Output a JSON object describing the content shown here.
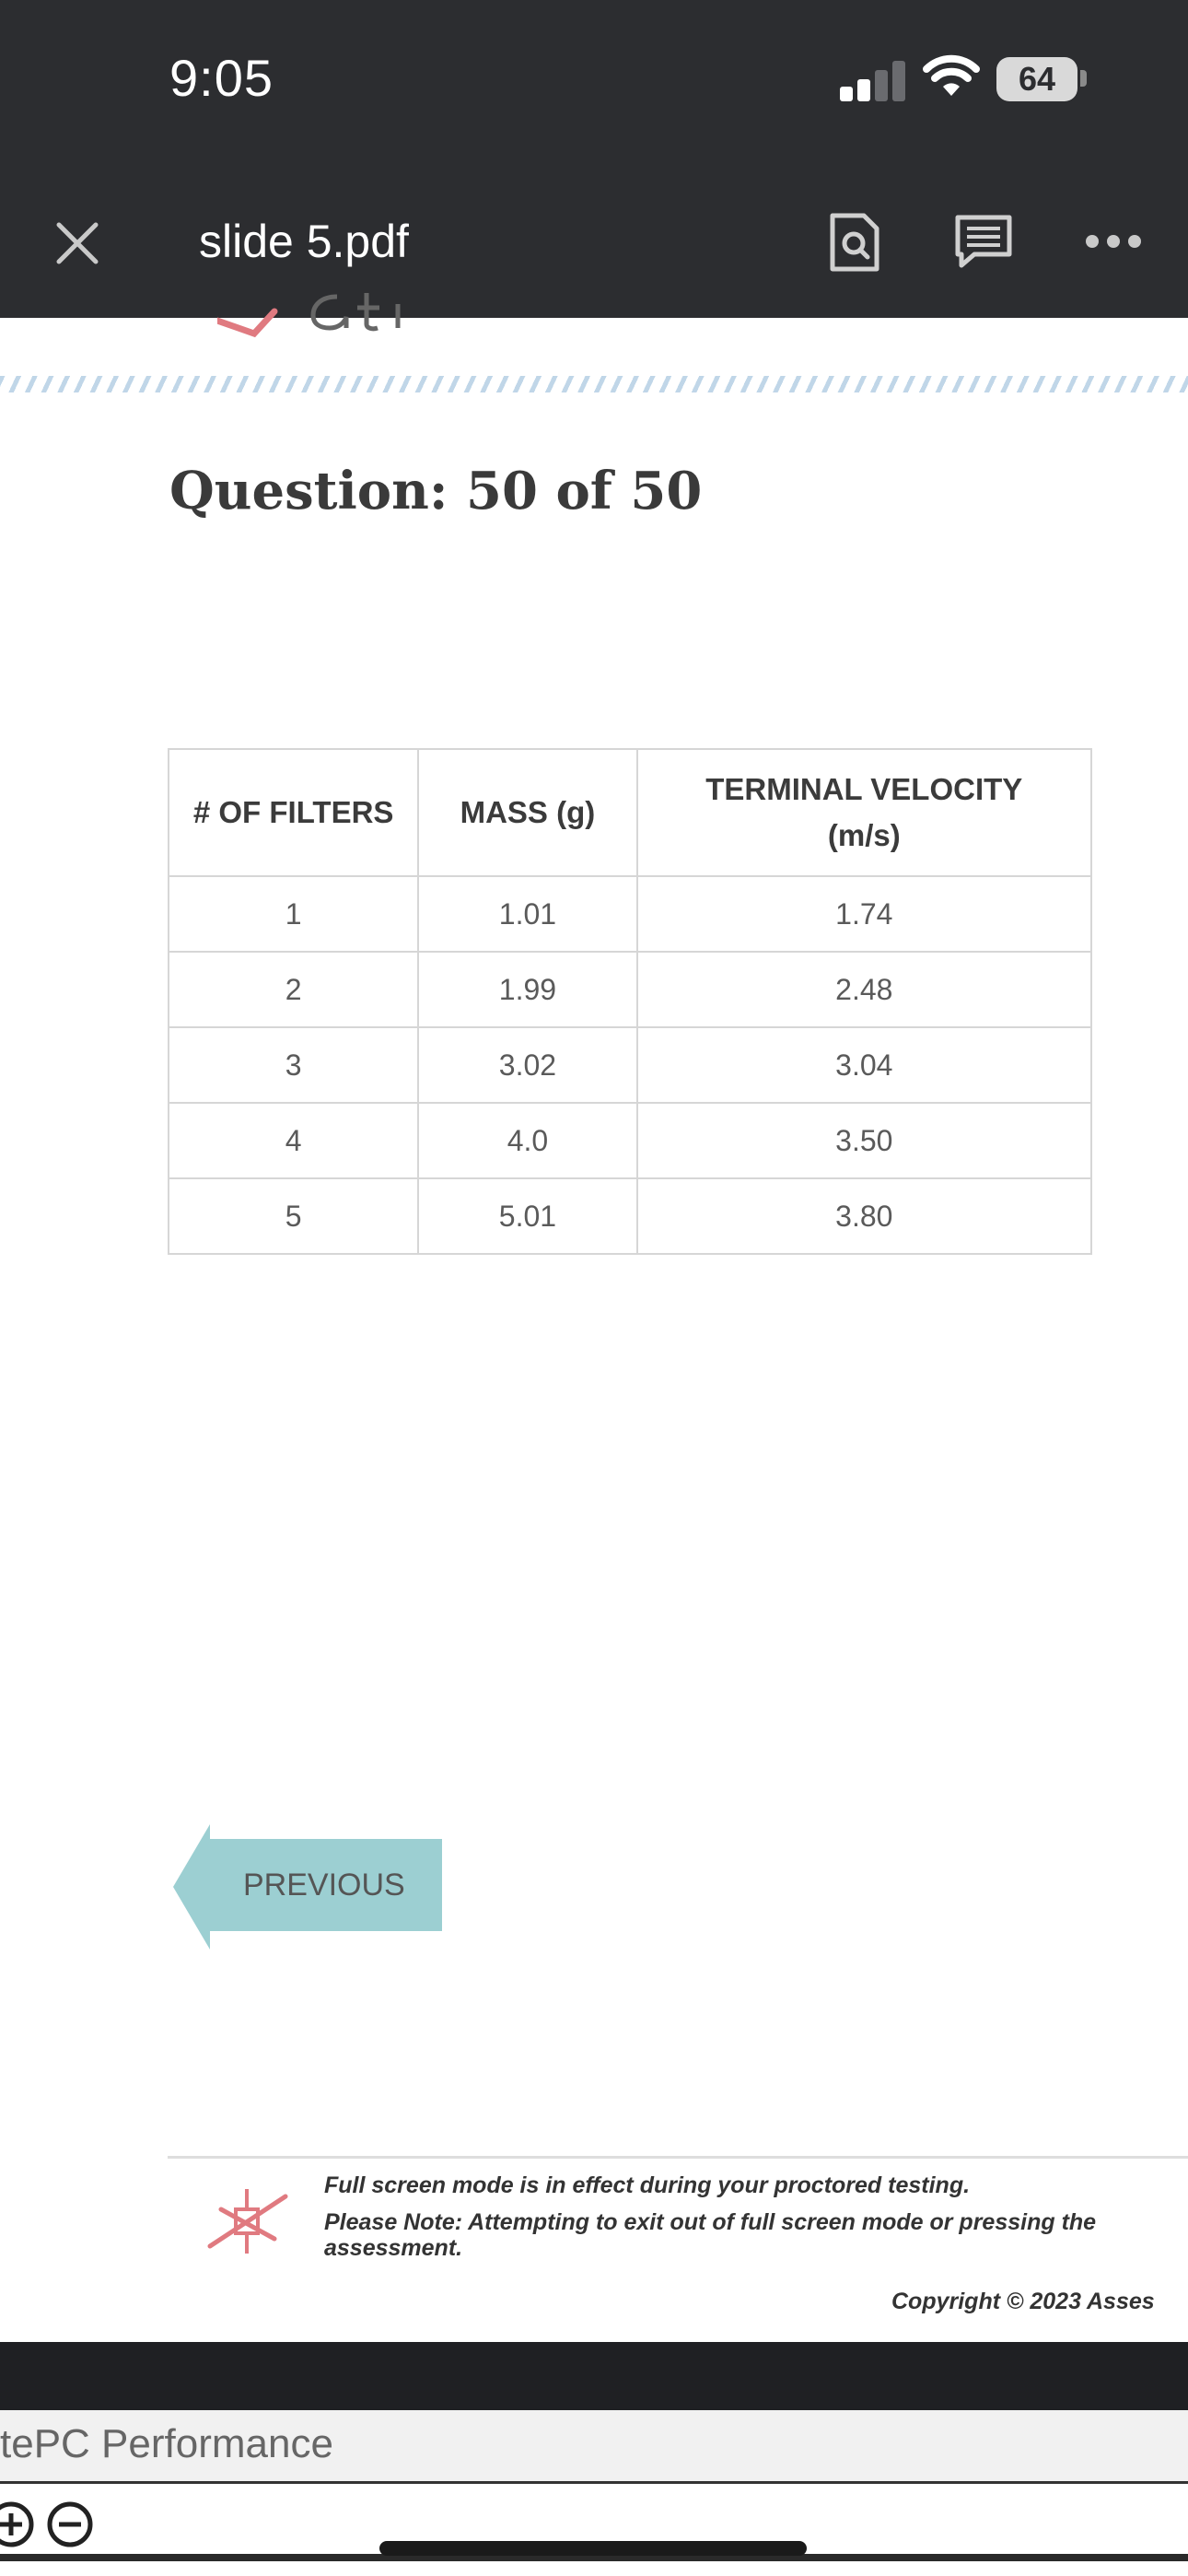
{
  "status_bar": {
    "time": "9:05",
    "battery": "64"
  },
  "nav_bar": {
    "title": "slide 5.pdf",
    "close_icon": "close-icon",
    "search_icon": "document-search-icon",
    "comment_icon": "comment-icon",
    "more_icon": "more-icon"
  },
  "document": {
    "question": "Question: 50 of 50",
    "table": {
      "headers": [
        "# OF FILTERS",
        "MASS (g)",
        "TERMINAL VELOCITY (m/s)"
      ],
      "rows": [
        [
          "1",
          "1.01",
          "1.74"
        ],
        [
          "2",
          "1.99",
          "2.48"
        ],
        [
          "3",
          "3.02",
          "3.04"
        ],
        [
          "4",
          "4.0",
          "3.50"
        ],
        [
          "5",
          "5.01",
          "3.80"
        ]
      ]
    },
    "previous_label": "PREVIOUS",
    "footer": {
      "line1": "Full screen mode is in effect during your proctored testing.",
      "line2": "Please Note: Attempting to exit out of full screen mode or pressing the",
      "line3": "assessment.",
      "copyright": "Copyright © 2023 Asses"
    }
  },
  "taskbar": {
    "label": "tePC Performance"
  },
  "colors": {
    "top_bar": "#2c2d30",
    "previous_button": "#9ccfd2",
    "logo_accent": "#e07a80"
  }
}
